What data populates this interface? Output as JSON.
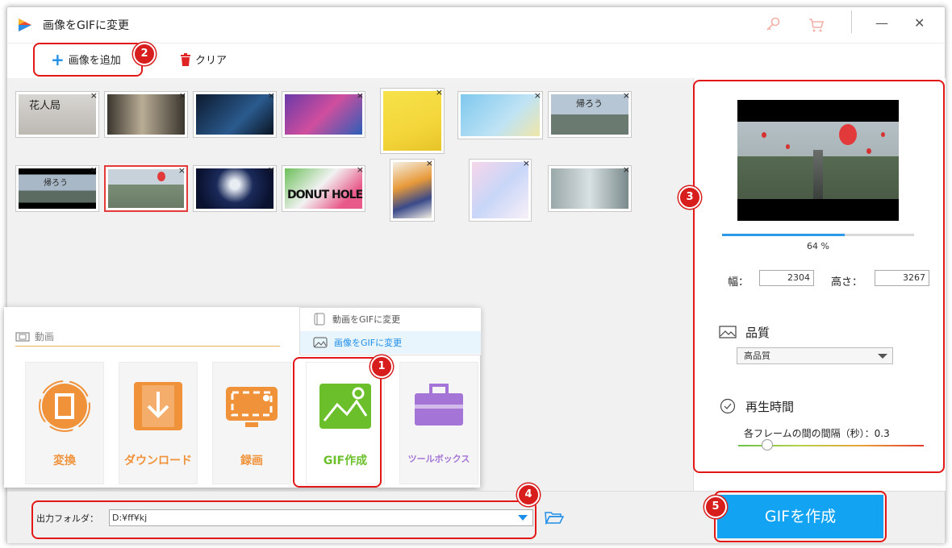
{
  "window": {
    "title": "画像をGIFに変更"
  },
  "titlebar_icons": [
    "key-icon",
    "cart-icon"
  ],
  "toolbar": {
    "add_label": "画像を追加",
    "clear_label": "クリア"
  },
  "badges": [
    "1",
    "2",
    "3",
    "4",
    "5"
  ],
  "thumbnails": [
    {
      "text": "花人局",
      "selected": false
    },
    {
      "text": "",
      "selected": false
    },
    {
      "text": "",
      "selected": false
    },
    {
      "text": "",
      "selected": false
    },
    {
      "text": "",
      "selected": false
    },
    {
      "text": "",
      "selected": false
    },
    {
      "text": "帰ろう",
      "selected": false
    },
    {
      "text": "帰ろう",
      "selected": false
    },
    {
      "text": "",
      "selected": true
    },
    {
      "text": "",
      "selected": false
    },
    {
      "text": "DONUT HOLE",
      "selected": false
    },
    {
      "text": "",
      "selected": false
    },
    {
      "text": "",
      "selected": false
    },
    {
      "text": "",
      "selected": false
    }
  ],
  "thumbnail_close": "×",
  "preview": {
    "progress_percent": 64,
    "progress_text": "64 %"
  },
  "size": {
    "width_label": "幅：",
    "width_value": "2304",
    "height_label": "高さ：",
    "height_value": "3267"
  },
  "quality": {
    "title": "品質",
    "value": "高品質"
  },
  "duration": {
    "title": "再生時間",
    "interval_label": "各フレームの間の間隔（秒）：0.3",
    "interval_level": 0.15
  },
  "popup": {
    "section_label": "動画",
    "tiles": [
      {
        "label": "変換",
        "color": "#f0923a"
      },
      {
        "label": "ダウンロード",
        "color": "#f0923a"
      },
      {
        "label": "録画",
        "color": "#f0923a"
      },
      {
        "label": "GIF作成",
        "color": "#6bbf2a"
      },
      {
        "label": "ツールボックス",
        "color": "#a474d6"
      }
    ],
    "submenu": [
      {
        "label": "動画をGIFに変更"
      },
      {
        "label": "画像をGIFに変更"
      }
    ]
  },
  "output": {
    "label": "出力フォルダ：",
    "path": "D:¥ff¥kj"
  },
  "create_button": "GIFを作成",
  "colors": {
    "accent": "#12a4f2",
    "highlight": "#e21818",
    "gif_green": "#6bbf2a",
    "orange": "#f0923a",
    "purple": "#a474d6"
  }
}
